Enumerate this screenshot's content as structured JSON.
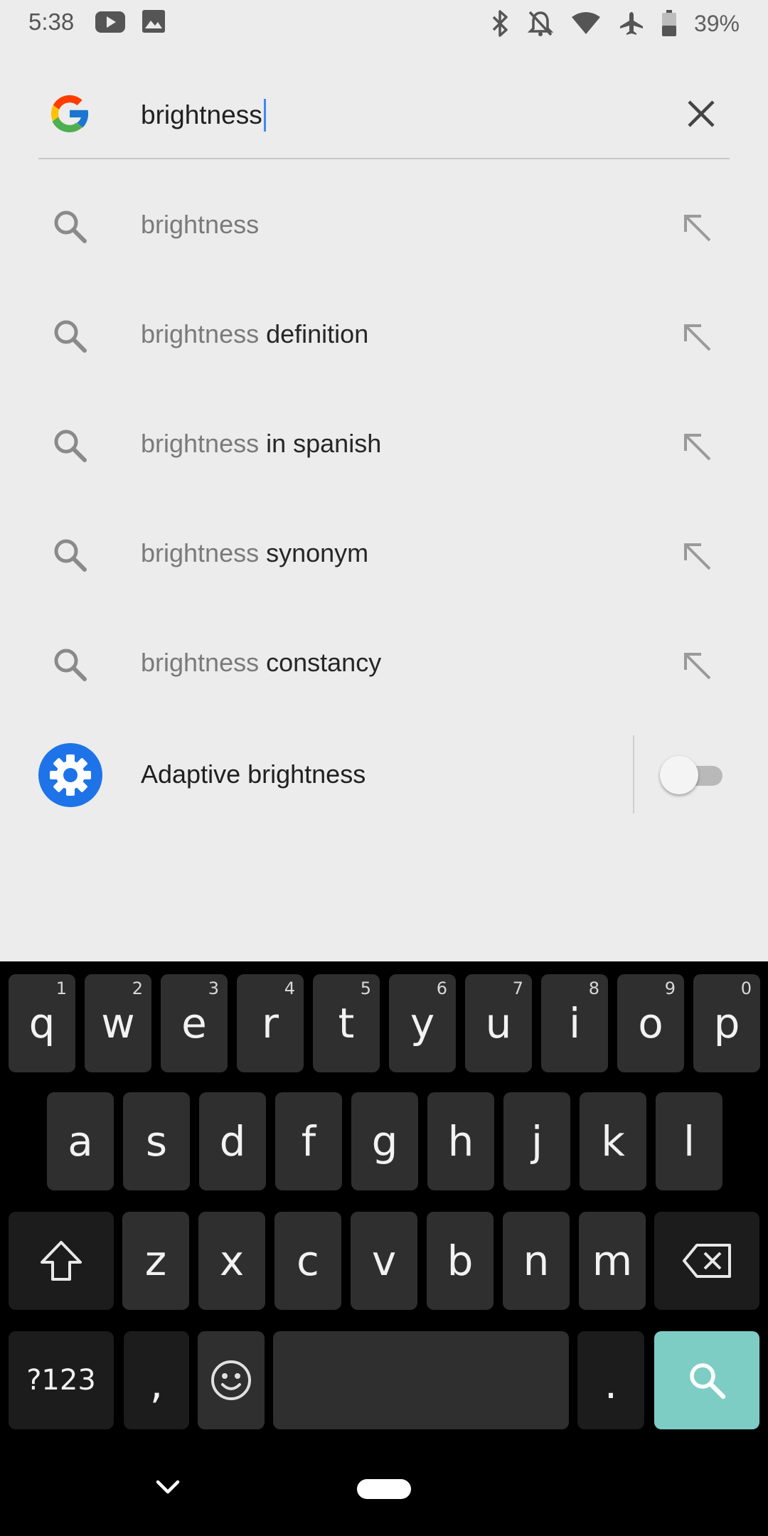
{
  "status_bar": {
    "time": "5:38",
    "left_icons": [
      "youtube-icon",
      "image-icon"
    ],
    "right_icons": [
      "bluetooth-icon",
      "notifications-off-icon",
      "wifi-icon",
      "airplane-icon",
      "battery-icon"
    ],
    "battery_percent": "39%"
  },
  "search": {
    "query": "brightness",
    "logo": "google-g-logo",
    "clear_icon": "close-icon"
  },
  "suggestions": [
    {
      "prefix": "brightness",
      "suffix": ""
    },
    {
      "prefix": "brightness",
      "suffix": " definition"
    },
    {
      "prefix": "brightness",
      "suffix": " in spanish"
    },
    {
      "prefix": "brightness",
      "suffix": " synonym"
    },
    {
      "prefix": "brightness",
      "suffix": " constancy"
    }
  ],
  "setting": {
    "label": "Adaptive brightness",
    "icon": "settings-gear-icon",
    "toggle_on": false
  },
  "keyboard": {
    "row1": [
      {
        "key": "q",
        "hint": "1"
      },
      {
        "key": "w",
        "hint": "2"
      },
      {
        "key": "e",
        "hint": "3"
      },
      {
        "key": "r",
        "hint": "4"
      },
      {
        "key": "t",
        "hint": "5"
      },
      {
        "key": "y",
        "hint": "6"
      },
      {
        "key": "u",
        "hint": "7"
      },
      {
        "key": "i",
        "hint": "8"
      },
      {
        "key": "o",
        "hint": "9"
      },
      {
        "key": "p",
        "hint": "0"
      }
    ],
    "row2": [
      "a",
      "s",
      "d",
      "f",
      "g",
      "h",
      "j",
      "k",
      "l"
    ],
    "row3": [
      "z",
      "x",
      "c",
      "v",
      "b",
      "n",
      "m"
    ],
    "symbols_label": "?123",
    "comma": ",",
    "period": ".",
    "enter_icon": "search-icon",
    "accent_color": "#7ecdc5"
  }
}
